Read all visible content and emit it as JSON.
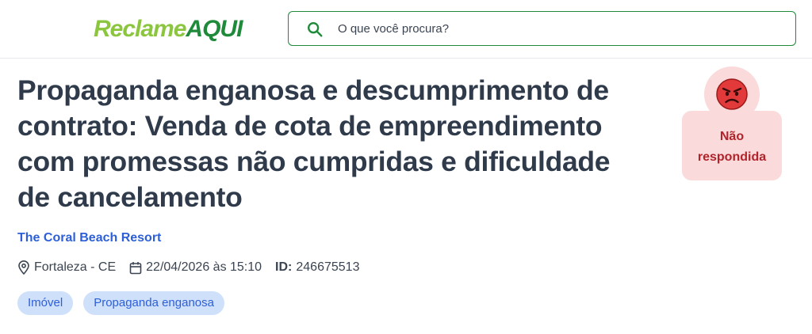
{
  "header": {
    "logo_part1": "Reclame",
    "logo_part2": "AQUI",
    "search": {
      "placeholder": "O que você procura?",
      "value": ""
    }
  },
  "complaint": {
    "title": "Propaganda enganosa e descumprimento de contrato: Venda de cota de empreendimento com promessas não cumpridas e dificuldade de cancelamento",
    "status_label_line1": "Não",
    "status_label_line2": "respondida",
    "company": "The Coral Beach Resort",
    "location": "Fortaleza - CE",
    "date": "22/04/2026 às 15:10",
    "id_label": "ID:",
    "id_value": "246675513",
    "tags": [
      "Imóvel",
      "Propaganda enganosa"
    ]
  },
  "colors": {
    "brand_light_green": "#8cc63f",
    "brand_dark_green": "#1e8a3a",
    "status_bg": "#fbdadb",
    "status_text": "#b0242b",
    "link_blue": "#2d5fd8",
    "tag_bg": "#cfe0fb"
  },
  "icons": {
    "search": "search-icon",
    "status": "angry-face-icon",
    "location": "map-pin-icon",
    "date": "calendar-icon"
  }
}
